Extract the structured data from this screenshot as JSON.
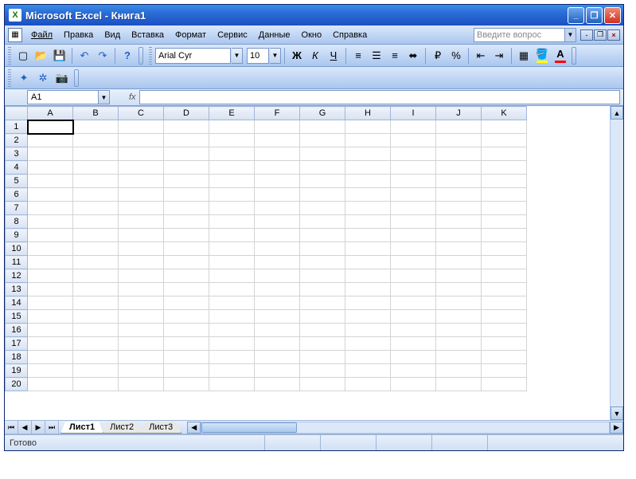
{
  "title": "Microsoft Excel - Книга1",
  "menu": {
    "file": "Файл",
    "edit": "Правка",
    "view": "Вид",
    "insert": "Вставка",
    "format": "Формат",
    "tools": "Сервис",
    "data": "Данные",
    "window": "Окно",
    "help": "Справка"
  },
  "help_placeholder": "Введите вопрос",
  "toolbar": {
    "font_name": "Arial Cyr",
    "font_size": "10"
  },
  "name_box": "A1",
  "fx": "fx",
  "columns": [
    "A",
    "B",
    "C",
    "D",
    "E",
    "F",
    "G",
    "H",
    "I",
    "J",
    "K"
  ],
  "rows": [
    1,
    2,
    3,
    4,
    5,
    6,
    7,
    8,
    9,
    10,
    11,
    12,
    13,
    14,
    15,
    16,
    17,
    18,
    19,
    20
  ],
  "active_cell": "A1",
  "sheets": {
    "s1": "Лист1",
    "s2": "Лист2",
    "s3": "Лист3"
  },
  "status": "Готово",
  "chart_data": null
}
